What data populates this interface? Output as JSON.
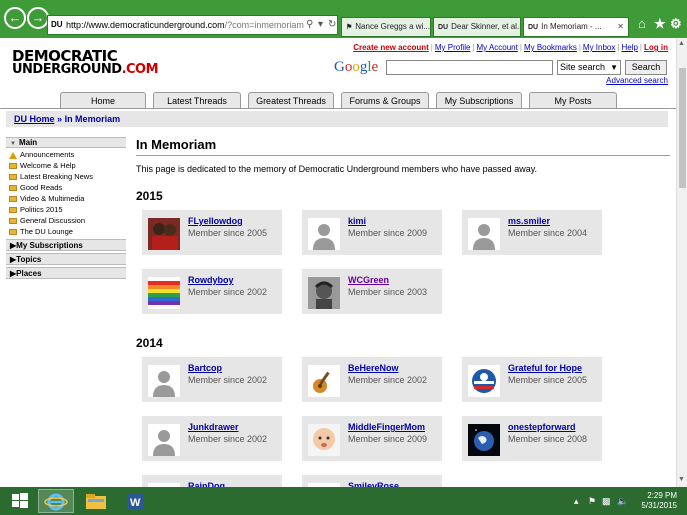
{
  "browser": {
    "url_host": "http://www.democraticunderground.com",
    "url_path": "/?com=inmemoriam",
    "favicon_text": "DU",
    "tabs": [
      {
        "label": "Nance Greggs a wi...",
        "icon": "DU"
      },
      {
        "label": "Dear Skinner, et al...",
        "icon": "DU"
      },
      {
        "label": "In Memoriam - ...",
        "icon": "DU"
      }
    ]
  },
  "logo": {
    "line1": "DEMOCRATIC",
    "line2": "UNDERGROUND",
    "suffix": ".COM"
  },
  "toplinks": {
    "create": "Create new account",
    "profile": "My Profile",
    "account": "My Account",
    "bookmarks": "My Bookmarks",
    "inbox": "My Inbox",
    "help": "Help",
    "login": "Log in"
  },
  "search": {
    "google": "Google",
    "scope": "Site search",
    "button": "Search",
    "advanced": "Advanced search"
  },
  "navtabs": [
    "Home",
    "Latest Threads",
    "Greatest Threads",
    "Forums & Groups",
    "My Subscriptions",
    "My Posts"
  ],
  "breadcrumb": {
    "home": "DU Home",
    "sep": "»",
    "current": "In Memoriam"
  },
  "sidebar": {
    "main_label": "Main",
    "items": [
      {
        "label": "Announcements",
        "icon": "warning-icon"
      },
      {
        "label": "Welcome & Help",
        "icon": "folder-icon"
      },
      {
        "label": "Latest Breaking News",
        "icon": "folder-icon"
      },
      {
        "label": "Good Reads",
        "icon": "folder-icon"
      },
      {
        "label": "Video & Multimedia",
        "icon": "folder-icon"
      },
      {
        "label": "Politics 2015",
        "icon": "folder-icon"
      },
      {
        "label": "General Discussion",
        "icon": "folder-icon"
      },
      {
        "label": "The DU Lounge",
        "icon": "folder-icon"
      }
    ],
    "sections": [
      "My Subscriptions",
      "Topics",
      "Places"
    ]
  },
  "main": {
    "title": "In Memoriam",
    "description": "This page is dedicated to the memory of Democratic Underground members who have passed away.",
    "years": [
      {
        "year": "2015",
        "members": [
          {
            "name": "FLyellowdog",
            "since": "Member since 2005",
            "avatar": "photo-couple"
          },
          {
            "name": "kimi",
            "since": "Member since 2009",
            "avatar": "default"
          },
          {
            "name": "ms.smiler",
            "since": "Member since 2004",
            "avatar": "default"
          },
          {
            "name": "Rowdyboy",
            "since": "Member since 2002",
            "avatar": "rainbow-flag"
          },
          {
            "name": "WCGreen",
            "since": "Member since 2003",
            "avatar": "photo-portrait",
            "visited": true
          }
        ]
      },
      {
        "year": "2014",
        "members": [
          {
            "name": "Bartcop",
            "since": "Member since 2002",
            "avatar": "default"
          },
          {
            "name": "BeHereNow",
            "since": "Member since 2002",
            "avatar": "guitar"
          },
          {
            "name": "Grateful for Hope",
            "since": "Member since 2005",
            "avatar": "obama-logo"
          },
          {
            "name": "Junkdrawer",
            "since": "Member since 2002",
            "avatar": "default"
          },
          {
            "name": "MiddleFingerMom",
            "since": "Member since 2009",
            "avatar": "baby-photo"
          },
          {
            "name": "onestepforward",
            "since": "Member since 2008",
            "avatar": "earth-photo"
          },
          {
            "name": "RainDog",
            "since": "",
            "avatar": "default"
          },
          {
            "name": "SmileyRose",
            "since": "",
            "avatar": "default"
          }
        ]
      }
    ]
  },
  "taskbar": {
    "time": "2:29 PM",
    "date": "5/31/2015"
  },
  "colors": {
    "chrome": "#3f9b38",
    "taskbar": "#2b6b30",
    "link": "#0000aa",
    "visited": "#660099",
    "card": "#e6e6e6"
  }
}
